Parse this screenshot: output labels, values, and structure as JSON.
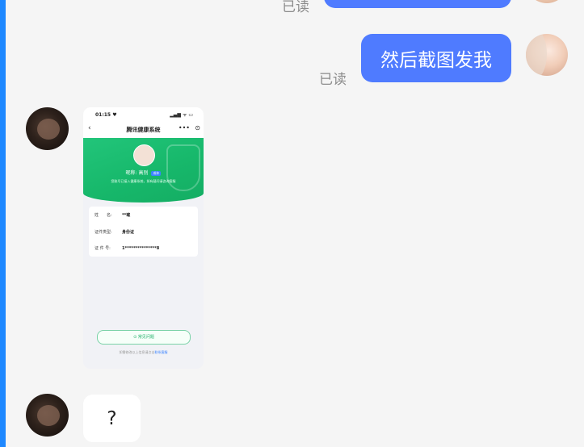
{
  "messages": [
    {
      "side": "right",
      "text": "",
      "read_status": "已读",
      "partial": true
    },
    {
      "side": "right",
      "text": "然后截图发我",
      "read_status": "已读"
    },
    {
      "side": "left",
      "type": "image",
      "phone": {
        "status_time": "01:15 ♥",
        "status_icons": "▂▄▆ ᯤ ▭",
        "nav_back": "‹",
        "nav_title": "腾讯健康系统",
        "nav_more": "•••",
        "nav_close": "⊙",
        "nick_label": "昵称:",
        "nick_value": "高别",
        "nick_badge": "成年",
        "hero_tip": "您账号已接入健康系统，如有疑问请咨询客服",
        "rows": [
          {
            "label": "姓　　名:",
            "value": "**璀"
          },
          {
            "label": "证件类型:",
            "value": "身份证"
          },
          {
            "label": "证 件 号:",
            "value": "1***************8"
          }
        ],
        "faq_button": "⊙ 常见问题",
        "footer_text": "如需修改以上信息请点击",
        "footer_link": "联系客服"
      }
    },
    {
      "side": "left",
      "type": "text",
      "text": "?"
    }
  ],
  "colors": {
    "bubble_out": "#4f7bff",
    "bubble_in": "#ffffff",
    "chat_bg": "#f5f5f5",
    "read_text": "#8c8c8c",
    "phone_green": "#1fbf72"
  }
}
